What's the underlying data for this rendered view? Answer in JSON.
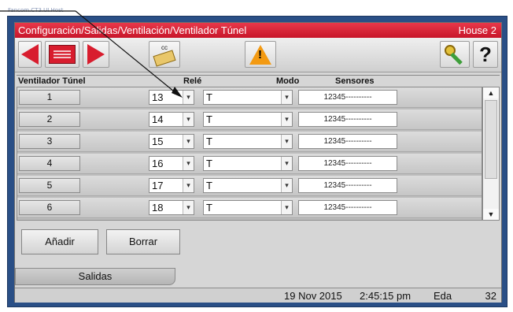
{
  "window": {
    "app_title": "Fancom.CT3.UI.Host"
  },
  "titlebar": {
    "path": "Configuración/Salidas/Ventilación/Ventilador Túnel",
    "house": "House 2"
  },
  "toolbar": {
    "cc_label": "cc",
    "help_label": "?"
  },
  "table": {
    "headers": {
      "fan": "Ventilador Túnel",
      "relay": "Relé",
      "mode": "Modo",
      "sensors": "Sensores"
    },
    "rows": [
      {
        "fan": "1",
        "relay": "13",
        "mode": "T",
        "sensors": "12345----------"
      },
      {
        "fan": "2",
        "relay": "14",
        "mode": "T",
        "sensors": "12345----------"
      },
      {
        "fan": "3",
        "relay": "15",
        "mode": "T",
        "sensors": "12345----------"
      },
      {
        "fan": "4",
        "relay": "16",
        "mode": "T",
        "sensors": "12345----------"
      },
      {
        "fan": "5",
        "relay": "17",
        "mode": "T",
        "sensors": "12345----------"
      },
      {
        "fan": "6",
        "relay": "18",
        "mode": "T",
        "sensors": "12345----------"
      }
    ],
    "dropdown_glyph": "▾",
    "scroll_up_glyph": "▲",
    "scroll_down_glyph": "▼"
  },
  "actions": {
    "add_label": "Añadir",
    "delete_label": "Borrar"
  },
  "tabs": {
    "active": "Salidas"
  },
  "status": {
    "date": "19 Nov 2015",
    "time": "2:45:15 pm",
    "user": "Eda",
    "number": "32"
  },
  "colors": {
    "titlebar": "#d81d2e",
    "frame": "#2a4f86",
    "warning": "#f39a12"
  }
}
